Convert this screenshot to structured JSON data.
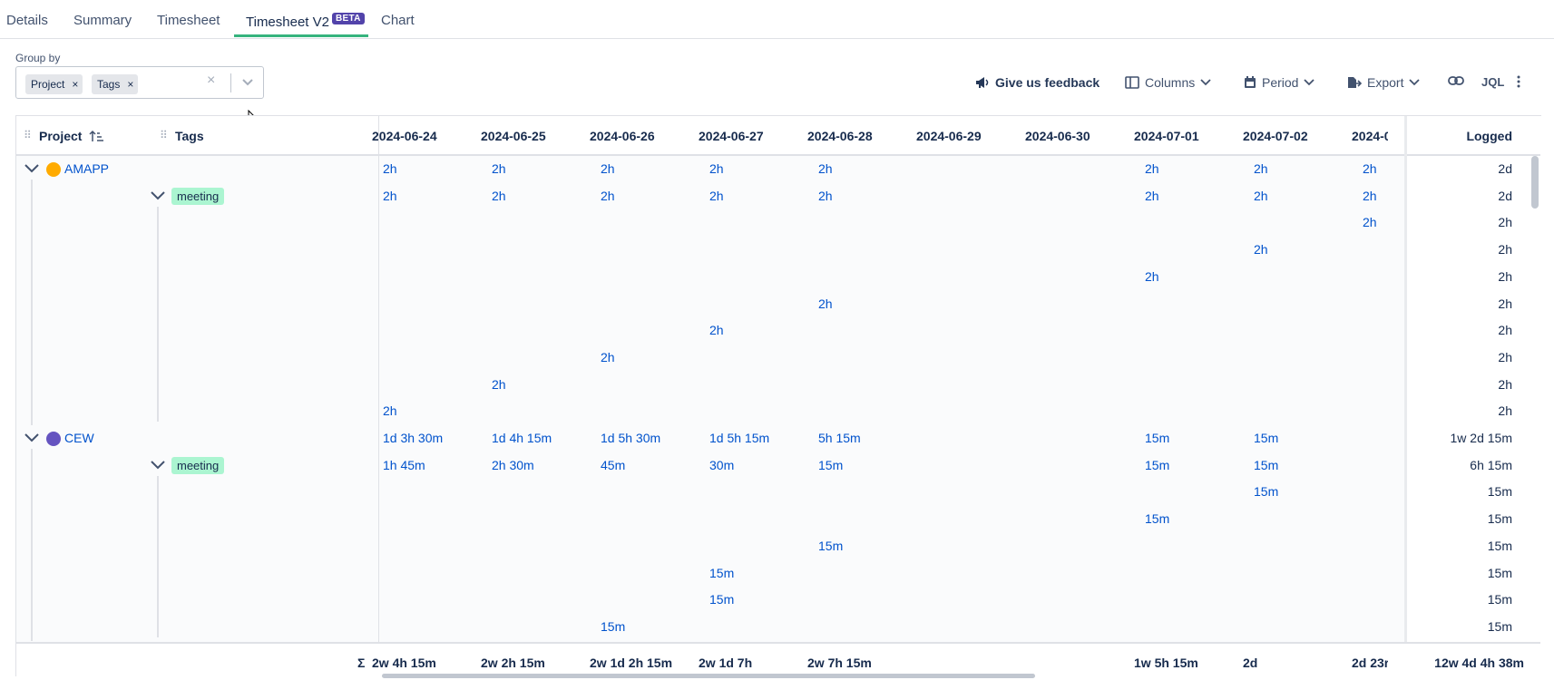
{
  "tabs": [
    {
      "label": "Details"
    },
    {
      "label": "Summary"
    },
    {
      "label": "Timesheet"
    },
    {
      "label": "Timesheet V2",
      "badge": "BETA",
      "active": true
    },
    {
      "label": "Chart"
    }
  ],
  "group_by": {
    "label": "Group by",
    "chips": [
      "Project",
      "Tags"
    ],
    "remove_glyph": "×",
    "clear_glyph": "×"
  },
  "toolbar": {
    "feedback": "Give us feedback",
    "columns": "Columns",
    "period": "Period",
    "export": "Export",
    "jql": "JQL"
  },
  "table": {
    "headers": {
      "project": "Project",
      "tags": "Tags",
      "logged": "Logged"
    },
    "dates": [
      "2024-06-24",
      "2024-06-25",
      "2024-06-26",
      "2024-06-27",
      "2024-06-28",
      "2024-06-29",
      "2024-06-30",
      "2024-07-01",
      "2024-07-02",
      "2024-0"
    ],
    "projects": [
      {
        "name": "AMAPP",
        "logged": "2d",
        "cells": [
          "2h",
          "2h",
          "2h",
          "2h",
          "2h",
          "",
          "",
          "2h",
          "2h",
          "2h"
        ],
        "tag": "meeting",
        "tag_logged": "2d",
        "tag_cells": [
          "2h",
          "2h",
          "2h",
          "2h",
          "2h",
          "",
          "",
          "2h",
          "2h",
          "2h"
        ],
        "rows": [
          {
            "cells": [
              "",
              "",
              "",
              "",
              "",
              "",
              "",
              "",
              "",
              "2h"
            ],
            "logged": "2h"
          },
          {
            "cells": [
              "",
              "",
              "",
              "",
              "",
              "",
              "",
              "",
              "2h",
              ""
            ],
            "logged": "2h"
          },
          {
            "cells": [
              "",
              "",
              "",
              "",
              "",
              "",
              "",
              "2h",
              "",
              ""
            ],
            "logged": "2h"
          },
          {
            "cells": [
              "",
              "",
              "",
              "",
              "2h",
              "",
              "",
              "",
              "",
              ""
            ],
            "logged": "2h"
          },
          {
            "cells": [
              "",
              "",
              "",
              "2h",
              "",
              "",
              "",
              "",
              "",
              ""
            ],
            "logged": "2h"
          },
          {
            "cells": [
              "",
              "",
              "2h",
              "",
              "",
              "",
              "",
              "",
              "",
              ""
            ],
            "logged": "2h"
          },
          {
            "cells": [
              "",
              "2h",
              "",
              "",
              "",
              "",
              "",
              "",
              "",
              ""
            ],
            "logged": "2h"
          },
          {
            "cells": [
              "2h",
              "",
              "",
              "",
              "",
              "",
              "",
              "",
              "",
              ""
            ],
            "logged": "2h"
          }
        ]
      },
      {
        "name": "CEW",
        "logged": "1w 2d 15m",
        "cells": [
          "1d 3h 30m",
          "1d 4h 15m",
          "1d 5h 30m",
          "1d 5h 15m",
          "5h 15m",
          "",
          "",
          "15m",
          "15m",
          ""
        ],
        "tag": "meeting",
        "tag_logged": "6h 15m",
        "tag_cells": [
          "1h 45m",
          "2h 30m",
          "45m",
          "30m",
          "15m",
          "",
          "",
          "15m",
          "15m",
          ""
        ],
        "rows": [
          {
            "cells": [
              "",
              "",
              "",
              "",
              "",
              "",
              "",
              "",
              "15m",
              ""
            ],
            "logged": "15m"
          },
          {
            "cells": [
              "",
              "",
              "",
              "",
              "",
              "",
              "",
              "15m",
              "",
              ""
            ],
            "logged": "15m"
          },
          {
            "cells": [
              "",
              "",
              "",
              "",
              "15m",
              "",
              "",
              "",
              "",
              ""
            ],
            "logged": "15m"
          },
          {
            "cells": [
              "",
              "",
              "",
              "15m",
              "",
              "",
              "",
              "",
              "",
              ""
            ],
            "logged": "15m"
          },
          {
            "cells": [
              "",
              "",
              "",
              "15m",
              "",
              "",
              "",
              "",
              "",
              ""
            ],
            "logged": "15m"
          },
          {
            "cells": [
              "",
              "",
              "15m",
              "",
              "",
              "",
              "",
              "",
              "",
              ""
            ],
            "logged": "15m"
          }
        ]
      }
    ],
    "footer": {
      "sigma": "Σ",
      "totals": [
        "2w 4h 15m",
        "2w 2h 15m",
        "2w 1d 2h 15m",
        "2w 1d 7h",
        "2w 7h 15m",
        "",
        "",
        "1w 5h 15m",
        "2d",
        "2d 23r"
      ],
      "logged": "12w 4d 4h 38m"
    }
  }
}
